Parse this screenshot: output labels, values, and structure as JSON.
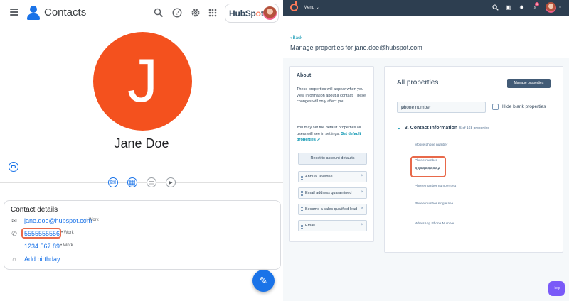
{
  "contacts": {
    "app_title": "Contacts",
    "icons": {
      "menu": "hamburger-menu-icon",
      "search": "search-icon",
      "help": "help-circle-icon",
      "settings": "gear-icon",
      "apps": "apps-grid-icon"
    },
    "hubspot_logo_text": "HubSpot",
    "avatar_initial": "J",
    "avatar_color": "#f4511e",
    "contact_name": "Jane Doe",
    "details": {
      "heading": "Contact details",
      "email": "jane.doe@hubspot.com",
      "email_type": "• Work",
      "phone_primary": "5555555556",
      "phone_primary_type": "• Work",
      "phone_secondary": "1234 567 89",
      "phone_secondary_type": "• Work",
      "add_birthday": "Add birthday"
    }
  },
  "hubspot": {
    "menu_label": "Menu",
    "notification_count": "3",
    "back_label": "Back",
    "page_heading": "Manage properties for jane.doe@hubspot.com",
    "about": {
      "title": "About",
      "paragraph1": "These properties will appear when you view information about a contact. These changes will only affect you.",
      "paragraph2_prefix": "You may set the default properties all users will see in settings.",
      "paragraph2_link": "Set default properties",
      "reset_button": "Reset to account defaults",
      "selected_properties": [
        "Annual revenue",
        "Email address quarantined",
        "Became a sales qualified lead",
        "Email"
      ]
    },
    "all_properties": {
      "title": "All properties",
      "manage_button": "Manage properties",
      "search_value": "phone number",
      "hide_blank_label": "Hide blank properties",
      "group_title": "3. Contact Information",
      "group_count": "5 of 168 properties",
      "properties": [
        {
          "label": "Mobile phone number",
          "value": ""
        },
        {
          "label": "Phone number",
          "value": "5555555556"
        },
        {
          "label": "Phone number number test",
          "value": ""
        },
        {
          "label": "Phone number single line",
          "value": ""
        },
        {
          "label": "WhatsApp Phone Number",
          "value": ""
        }
      ]
    },
    "help_label": "Help",
    "accent_color": "#ff7a59",
    "highlight_color": "#e8694a"
  }
}
